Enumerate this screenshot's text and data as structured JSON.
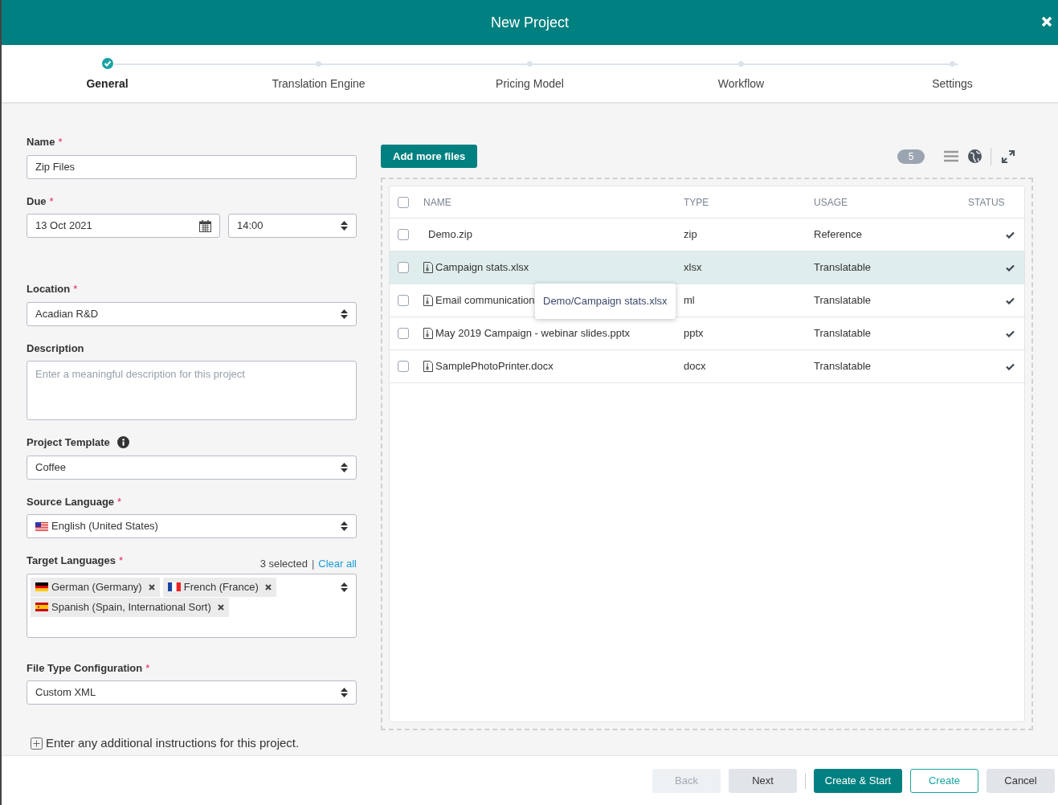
{
  "window": {
    "title": "New Project"
  },
  "steps": [
    {
      "label": "General",
      "done": true,
      "selected": true
    },
    {
      "label": "Translation Engine",
      "done": false,
      "selected": false
    },
    {
      "label": "Pricing Model",
      "done": false,
      "selected": false
    },
    {
      "label": "Workflow",
      "done": false,
      "selected": false
    },
    {
      "label": "Settings",
      "done": false,
      "selected": false
    }
  ],
  "form": {
    "name": {
      "label": "Name",
      "mark": "*",
      "value": "Zip Files"
    },
    "due": {
      "label": "Due",
      "mark": "*",
      "date": "13 Oct 2021",
      "time": "14:00"
    },
    "location": {
      "label": "Location",
      "mark": "*",
      "value": "Acadian R&D"
    },
    "description": {
      "label": "Description",
      "placeholder": "Enter a meaningful description for this project"
    },
    "template": {
      "label": "Project Template",
      "value": "Coffee"
    },
    "source": {
      "label": "Source Language",
      "mark": "*",
      "value": "English (United States)",
      "kind": "us"
    },
    "targets": {
      "label": "Target Languages",
      "mark": "*",
      "count": "3 selected",
      "separator": "|",
      "clear": "Clear all",
      "items": [
        {
          "label": "German (Germany)",
          "kind": "de"
        },
        {
          "label": "French (France)",
          "kind": "fr"
        },
        {
          "label": "Spanish (Spain, International Sort)",
          "kind": "es"
        }
      ]
    },
    "filetype": {
      "label": "File Type Configuration",
      "mark": "*",
      "value": "Custom XML"
    },
    "instructions": "Enter any additional instructions for this project."
  },
  "files": {
    "add_button": "Add more files",
    "count": "5",
    "columns": [
      "NAME",
      "TYPE",
      "USAGE",
      "STATUS"
    ],
    "header_checked": false,
    "rows": [
      {
        "name": "Demo.zip",
        "kind": "archive",
        "type": "zip",
        "usage": "Reference",
        "checked": false,
        "highlighted": false,
        "done": true
      },
      {
        "name": "Campaign stats.xlsx",
        "kind": "file",
        "type": "xlsx",
        "usage": "Translatable",
        "checked": false,
        "highlighted": true,
        "done": true
      },
      {
        "name": "Email communication",
        "kind": "file",
        "type": "ml",
        "usage": "Translatable",
        "checked": false,
        "highlighted": false,
        "done": true
      },
      {
        "name": "May 2019 Campaign - webinar slides.pptx",
        "kind": "file",
        "type": "pptx",
        "usage": "Translatable",
        "checked": false,
        "highlighted": false,
        "done": true
      },
      {
        "name": "SamplePhotoPrinter.docx",
        "kind": "file",
        "type": "docx",
        "usage": "Translatable",
        "checked": false,
        "highlighted": false,
        "done": true
      }
    ],
    "tooltip": {
      "text": "Demo/Campaign stats.xlsx"
    }
  },
  "footer": [
    {
      "label": "Back",
      "kind": "secondary",
      "disabled": true
    },
    {
      "label": "Next",
      "kind": "secondary",
      "disabled": false
    },
    {
      "label": "Create & Start",
      "kind": "primary",
      "disabled": false
    },
    {
      "label": "Create",
      "kind": "outline",
      "disabled": false
    },
    {
      "label": "Cancel",
      "kind": "secondary",
      "disabled": false
    }
  ]
}
